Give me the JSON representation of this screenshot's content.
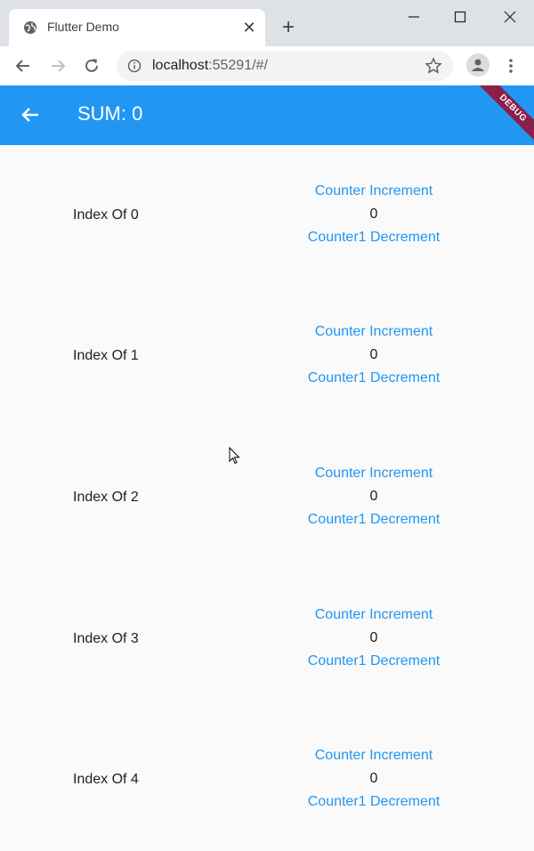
{
  "browser": {
    "tab_title": "Flutter Demo",
    "tab_close": "✕",
    "new_tab": "+",
    "url_host": "localhost",
    "url_rest": ":55291/#/"
  },
  "app": {
    "title": "SUM: 0",
    "debug_banner": "DEBUG",
    "primary_color": "#2196f3"
  },
  "items": [
    {
      "label": "Index Of 0",
      "increment": "Counter Increment",
      "count": "0",
      "decrement": "Counter1 Decrement"
    },
    {
      "label": "Index Of 1",
      "increment": "Counter Increment",
      "count": "0",
      "decrement": "Counter1 Decrement"
    },
    {
      "label": "Index Of 2",
      "increment": "Counter Increment",
      "count": "0",
      "decrement": "Counter1 Decrement"
    },
    {
      "label": "Index Of 3",
      "increment": "Counter Increment",
      "count": "0",
      "decrement": "Counter1 Decrement"
    },
    {
      "label": "Index Of 4",
      "increment": "Counter Increment",
      "count": "0",
      "decrement": "Counter1 Decrement"
    }
  ]
}
